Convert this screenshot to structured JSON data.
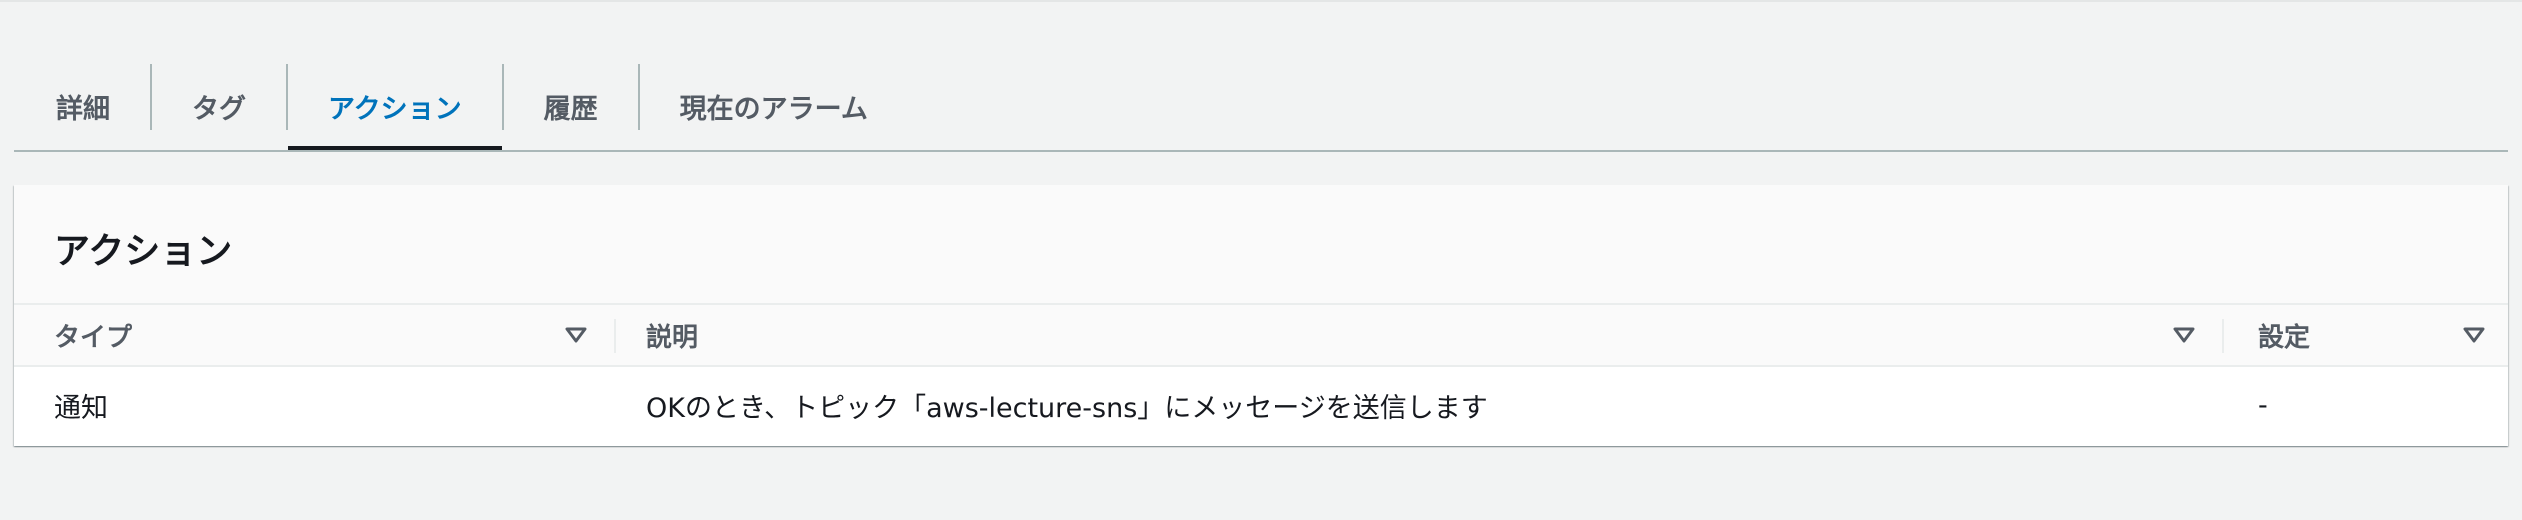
{
  "tabs": [
    {
      "label": "詳細",
      "active": false
    },
    {
      "label": "タグ",
      "active": false
    },
    {
      "label": "アクション",
      "active": true
    },
    {
      "label": "履歴",
      "active": false
    },
    {
      "label": "現在のアラーム",
      "active": false
    }
  ],
  "panel": {
    "title": "アクション",
    "columns": [
      "タイプ",
      "説明",
      "設定"
    ],
    "rows": [
      {
        "type": "通知",
        "description": "OKのとき、トピック「aws-lecture-sns」にメッセージを送信します",
        "settings": "-"
      }
    ]
  },
  "colors": {
    "active_tab": "#0073bb",
    "text": "#16191f",
    "muted_text": "#545b64",
    "background": "#f2f3f3"
  },
  "icons": {
    "sort": "caret-down-outline-icon"
  }
}
